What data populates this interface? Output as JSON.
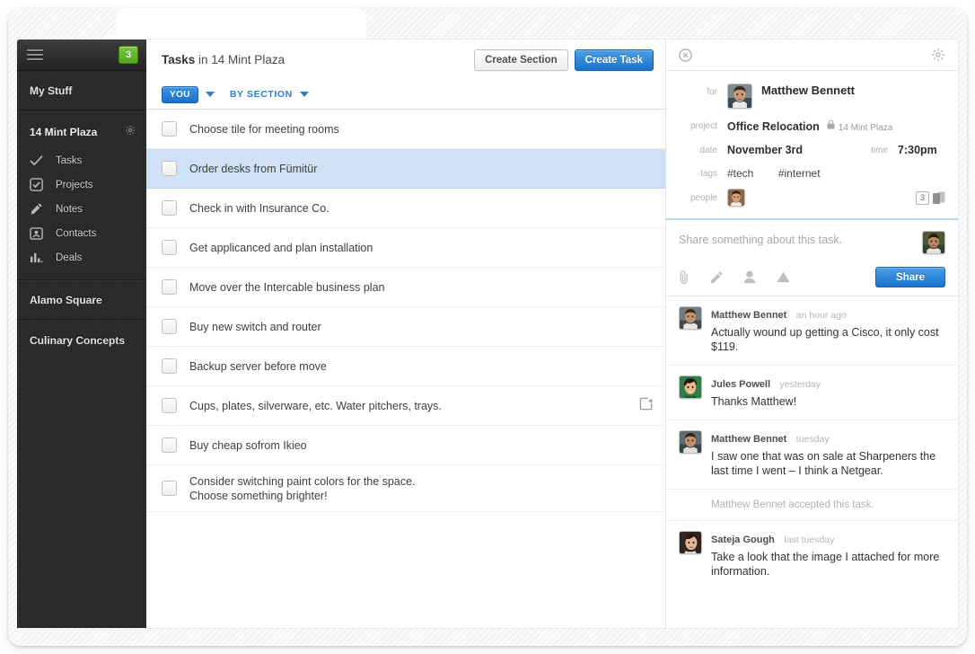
{
  "sidebar": {
    "menu_icon": "hamburger-icon",
    "badge_count": "3",
    "my_stuff_label": "My Stuff",
    "my_stuff_gear": "gear-icon",
    "project": {
      "name": "14 Mint Plaza",
      "gear": "gear-icon",
      "items": [
        {
          "label": "Tasks",
          "icon": "check-icon"
        },
        {
          "label": "Projects",
          "icon": "checkbox-square-icon"
        },
        {
          "label": "Notes",
          "icon": "pencil-icon"
        },
        {
          "label": "Contacts",
          "icon": "contact-card-icon"
        },
        {
          "label": "Deals",
          "icon": "bar-chart-icon"
        }
      ]
    },
    "other_projects": [
      {
        "label": "Alamo Square"
      },
      {
        "label": "Culinary Concepts"
      }
    ]
  },
  "main": {
    "title_bold": "Tasks",
    "title_rest": " in 14 Mint Plaza",
    "create_section_label": "Create Section",
    "create_task_label": "Create Task",
    "filter_you_label": "YOU",
    "filter_you_caret": "chevron-down-icon",
    "filter_section_label": "BY SECTION",
    "filter_section_caret": "chevron-down-icon",
    "tasks": [
      {
        "text": "Choose tile for meeting rooms",
        "selected": false,
        "action": null
      },
      {
        "text": "Order desks from Fümitür",
        "selected": true,
        "action": null
      },
      {
        "text": "Check in with Insurance Co.",
        "selected": false,
        "action": null
      },
      {
        "text": "Get applicanced and plan installation",
        "selected": false,
        "action": null
      },
      {
        "text": "Move over the Intercable business plan",
        "selected": false,
        "action": null
      },
      {
        "text": "Buy new switch and router",
        "selected": false,
        "action": null
      },
      {
        "text": "Backup server before move",
        "selected": false,
        "action": null
      },
      {
        "text": "Cups, plates, silverware, etc. Water pitchers, trays.",
        "selected": false,
        "action": "forward-icon"
      },
      {
        "text": "Buy cheap sofrom Ikieo",
        "selected": false,
        "action": null
      },
      {
        "text": "Consider switching paint colors for the space.",
        "text_line2": "Choose something brighter!",
        "selected": false,
        "action": null
      }
    ]
  },
  "panel": {
    "close_icon": "close-icon",
    "settings_icon": "gear-icon",
    "meta": {
      "for_key": "for",
      "for_value": "Matthew Bennett",
      "project_key": "project",
      "project_value": "Office Relocation",
      "project_lock_icon": "lock-icon",
      "project_sub": "14 Mint Plaza",
      "date_key": "date",
      "date_value": "November 3rd",
      "time_key": "time",
      "time_value": "7:30pm",
      "tags_key": "tags",
      "tags": [
        "#tech",
        "#internet"
      ],
      "people_key": "people",
      "people_count": "3",
      "people_icon": "people-stack-icon"
    },
    "composer": {
      "placeholder": "Share something about this task.",
      "share_label": "Share",
      "tools": [
        {
          "icon": "paperclip-icon"
        },
        {
          "icon": "pencil-icon"
        },
        {
          "icon": "person-icon"
        },
        {
          "icon": "cloud-icon"
        }
      ]
    },
    "comments": [
      {
        "type": "comment",
        "author": "Matthew Bennet",
        "time": "an hour ago",
        "text": "Actually wound up getting a Cisco, it only cost $119.",
        "avatar": "matthew"
      },
      {
        "type": "comment",
        "author": "Jules Powell",
        "time": "yesterday",
        "text": "Thanks Matthew!",
        "avatar": "jules"
      },
      {
        "type": "comment",
        "author": "Matthew Bennet",
        "time": "tuesday",
        "text": "I saw one that was on sale at Sharpeners the last time I went – I think a Netgear.",
        "avatar": "matthew"
      },
      {
        "type": "system",
        "text": "Matthew Bennet accepted this task."
      },
      {
        "type": "comment",
        "author": "Sateja Gough",
        "time": "last tuesday",
        "text": "Take a look that the image I attached for more information.",
        "avatar": "sateja"
      }
    ]
  },
  "colors": {
    "accent_blue": "#1c72cc",
    "selected_row": "#cfe2f5",
    "badge_green": "#66b82f",
    "sidebar_dark": "#2b2b2b"
  }
}
